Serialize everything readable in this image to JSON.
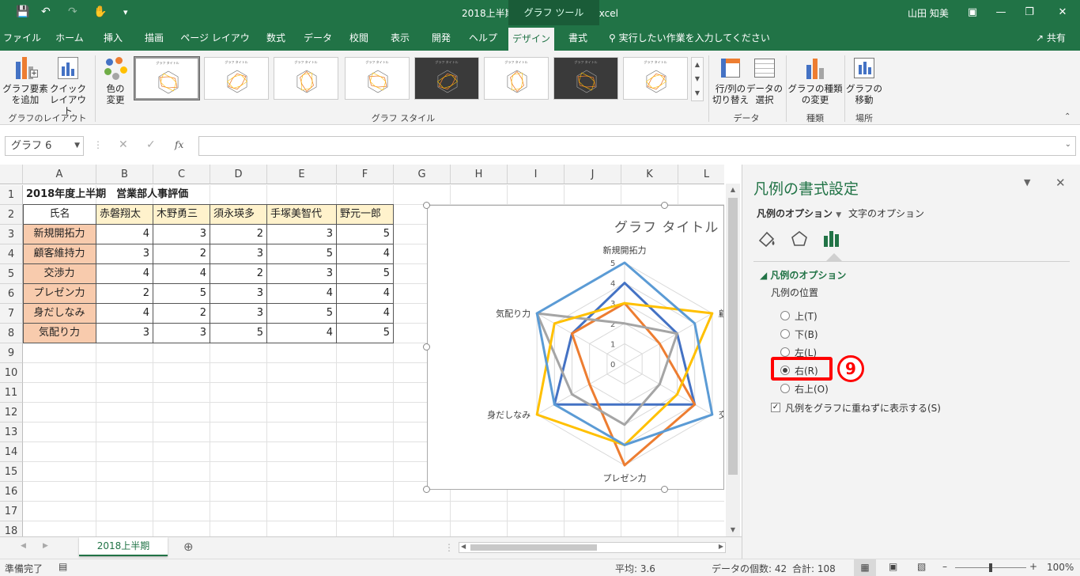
{
  "title": "2018上半期営業部評価.xlsx  -  Excel",
  "context_tool": "グラフ ツール",
  "user": "山田 知美",
  "tabs": [
    "ファイル",
    "ホーム",
    "挿入",
    "描画",
    "ページ レイアウト",
    "数式",
    "データ",
    "校閲",
    "表示",
    "開発",
    "ヘルプ",
    "デザイン",
    "書式"
  ],
  "tell_me": "実行したい作業を入力してください",
  "share": "共有",
  "ribbon": {
    "add_element": [
      "グラフ要素",
      "を追加"
    ],
    "quick_layout": [
      "クイック",
      "レイアウト"
    ],
    "change_colors": [
      "色の",
      "変更"
    ],
    "group_layout": "グラフのレイアウト",
    "group_styles": "グラフ スタイル",
    "switch_rowcol": [
      "行/列の",
      "切り替え"
    ],
    "select_data": [
      "データの",
      "選択"
    ],
    "group_data": "データ",
    "change_type": [
      "グラフの種類",
      "の変更"
    ],
    "group_type": "種類",
    "move_chart": [
      "グラフの",
      "移動"
    ],
    "group_location": "場所",
    "thumb_title": "グラフ タイトル"
  },
  "namebox": "グラフ 6",
  "fx": "fx",
  "columns": [
    "A",
    "B",
    "C",
    "D",
    "E",
    "F",
    "G",
    "H",
    "I",
    "J",
    "K",
    "L"
  ],
  "rows": [
    "1",
    "2",
    "3",
    "4",
    "5",
    "6",
    "7",
    "8",
    "9",
    "10",
    "11",
    "12",
    "13",
    "14",
    "15",
    "16",
    "17",
    "18"
  ],
  "sheet": {
    "title": "2018年度上半期　営業部人事評価",
    "header_label": "氏名",
    "people": [
      "赤磐翔太",
      "木野勇三",
      "須永瑛多",
      "手塚美智代",
      "野元一郎"
    ],
    "criteria": [
      "新規開拓力",
      "顧客維持力",
      "交渉力",
      "プレゼン力",
      "身だしなみ",
      "気配り力"
    ],
    "scores": [
      [
        4,
        3,
        2,
        3,
        5
      ],
      [
        3,
        2,
        3,
        5,
        4
      ],
      [
        4,
        4,
        2,
        3,
        5
      ],
      [
        2,
        5,
        3,
        4,
        4
      ],
      [
        4,
        2,
        3,
        5,
        4
      ],
      [
        3,
        3,
        5,
        4,
        5
      ]
    ]
  },
  "chart_data": {
    "type": "radar",
    "title": "グラフ タイトル",
    "axes": [
      "新規開拓力",
      "顧客維持力",
      "交渉力",
      "プレゼン力",
      "身だしなみ",
      "気配り力"
    ],
    "axis_labels_visible": [
      "新規開拓力",
      "顧",
      "交",
      "プレゼン力",
      "身だしなみ",
      "気配り力"
    ],
    "ticks": [
      "0",
      "1",
      "2",
      "3",
      "4",
      "5"
    ],
    "rmax": 5,
    "series": [
      {
        "values": [
          4,
          3,
          4,
          2,
          4,
          3
        ],
        "color": "#4472C4"
      },
      {
        "values": [
          3,
          2,
          4,
          5,
          2,
          3
        ],
        "color": "#ED7D31"
      },
      {
        "values": [
          2,
          3,
          2,
          3,
          3,
          5
        ],
        "color": "#A5A5A5"
      },
      {
        "values": [
          3,
          5,
          3,
          4,
          5,
          4
        ],
        "color": "#FFC000"
      },
      {
        "values": [
          5,
          4,
          5,
          4,
          4,
          5
        ],
        "color": "#5B9BD5"
      }
    ]
  },
  "sheet_tab": "2018上半期",
  "status": {
    "ready": "準備完了",
    "average": "平均: 3.6",
    "count": "データの個数: 42",
    "sum": "合計: 108",
    "zoom": "100%"
  },
  "pane": {
    "title": "凡例の書式設定",
    "tab_legend": "凡例のオプション",
    "tab_text": "文字のオプション",
    "section": "凡例のオプション",
    "position_label": "凡例の位置",
    "options": [
      "上(T)",
      "下(B)",
      "左(L)",
      "右(R)",
      "右上(O)"
    ],
    "selected": 3,
    "overlap_label": "凡例をグラフに重ねずに表示する(S)",
    "marker": "9"
  },
  "colors": {
    "excel_green": "#217346",
    "header_fill": "#FFF2CC",
    "criteria_fill": "#F8CBAD",
    "highlight": "#FF0000"
  }
}
